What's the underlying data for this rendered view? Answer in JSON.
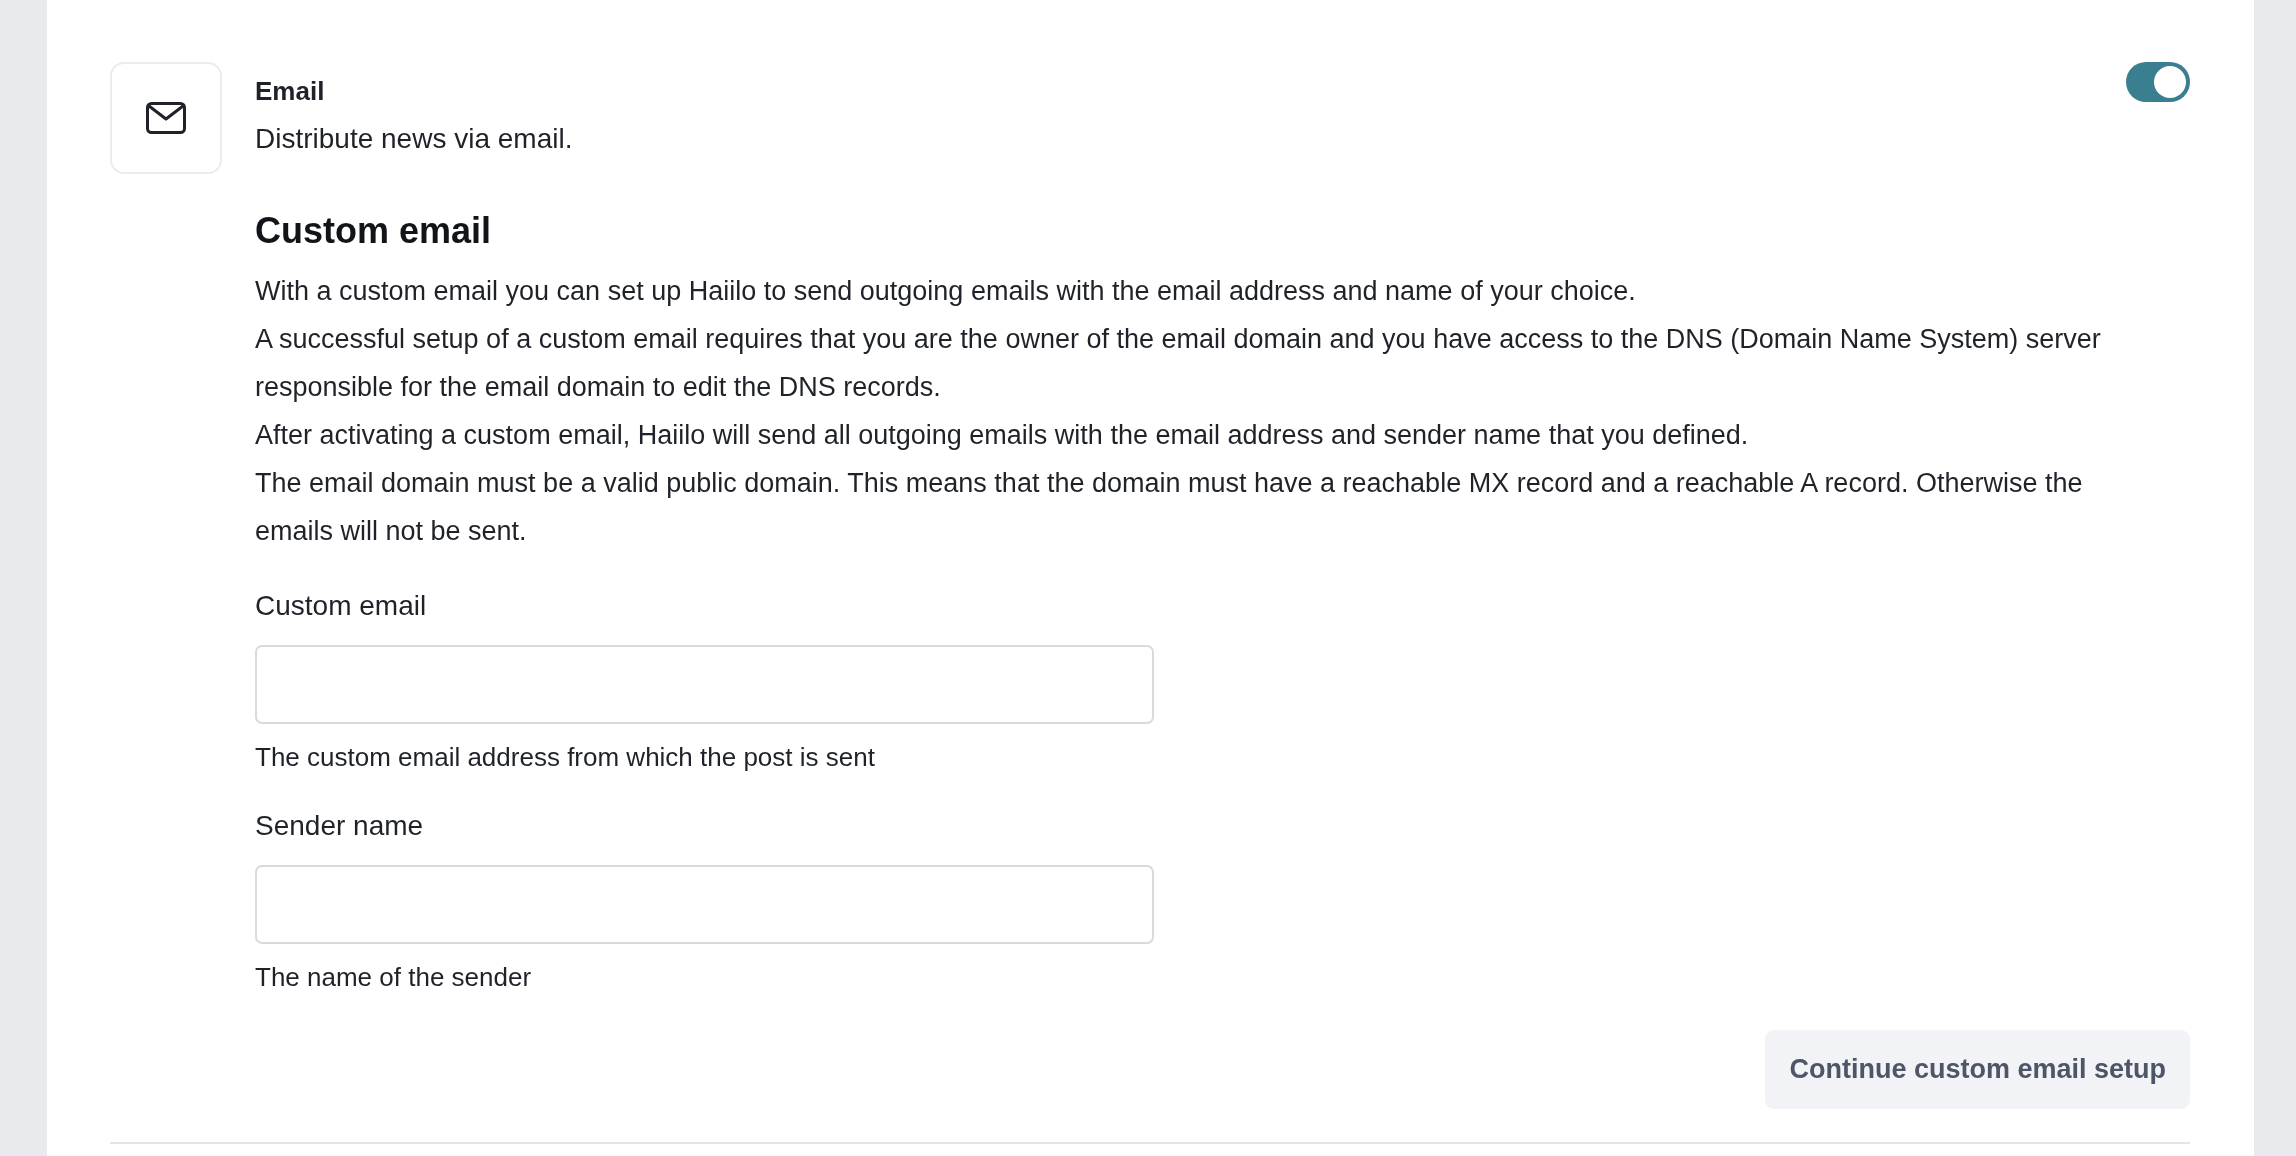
{
  "channel": {
    "title": "Email",
    "description": "Distribute news via email.",
    "on": true
  },
  "custom_email": {
    "heading": "Custom email",
    "paragraphs": [
      "With a custom email you can set up Haiilo to send outgoing emails with the email address and name of your choice.",
      "A successful setup of a custom email requires that you are the owner of the email domain and you have access to the DNS (Domain Name System) server responsible for the email domain to edit the DNS records.",
      "After activating a custom email, Haiilo will send all outgoing emails with the email address and sender name that you defined.",
      "The email domain must be a valid public domain. This means that the domain must have a reachable MX record and a reachable A record. Otherwise the emails will not be sent."
    ],
    "fields": [
      {
        "label": "Custom email",
        "help": "The custom email address from which the post is sent"
      },
      {
        "label": "Sender name",
        "help": "The name of the sender"
      }
    ],
    "button": "Continue custom email setup"
  }
}
